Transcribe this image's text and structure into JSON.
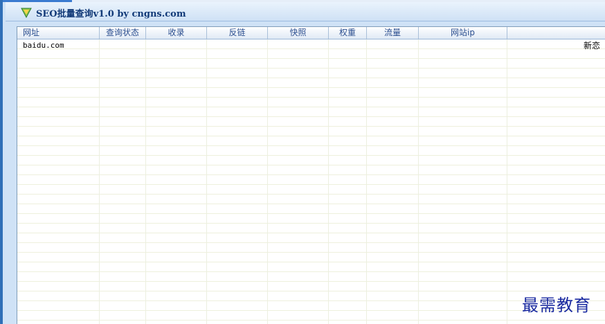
{
  "window": {
    "title": "SEO批量查询v1.0 by cngns.com",
    "icon": "shield-icon"
  },
  "table": {
    "columns": [
      "网址",
      "查询状态",
      "收录",
      "反链",
      "快照",
      "权重",
      "流量",
      "网站ip",
      ""
    ],
    "rows": [
      {
        "url": "baidu.com",
        "extra": "新恋"
      }
    ]
  },
  "watermark": "最需教育",
  "colors": {
    "title_text": "#123a78",
    "header_text": "#2b4e8f",
    "grid_line": "#eef0dc",
    "watermark": "#1a2aa0"
  }
}
